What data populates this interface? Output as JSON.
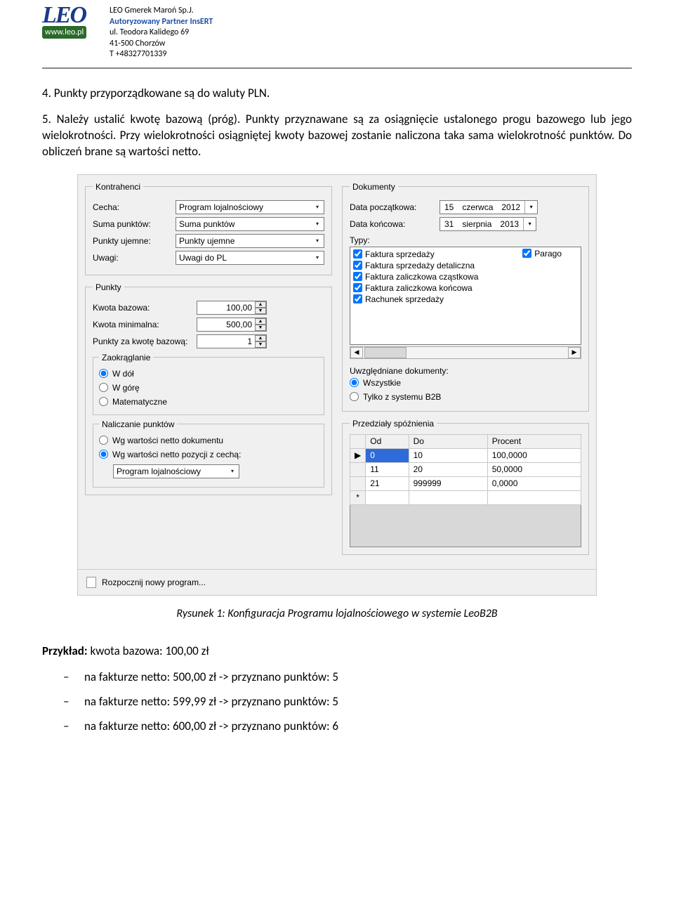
{
  "header": {
    "company1": "LEO Gmerek Maroń Sp.J.",
    "company2": "Autoryzowany Partner InsERT",
    "company3": "ul. Teodora Kalidego 69",
    "company4": "41-500 Chorzów",
    "company5": "T +48327701339",
    "logo_text": "LEO",
    "logo_url": "www.leo.pl"
  },
  "body": {
    "para4": "4. Punkty przyporządkowane są do waluty PLN.",
    "para5": "5. Należy ustalić kwotę bazową (próg). Punkty przyznawane są za osiągnięcie ustalonego progu bazowego lub jego wielokrotności. Przy wielokrotności osiągniętej kwoty bazowej zostanie naliczona taka sama wielokrotność punktów. Do obliczeń brane są wartości netto."
  },
  "dialog": {
    "kontrahenci": {
      "legend": "Kontrahenci",
      "cecha_label": "Cecha:",
      "cecha_value": "Program lojalnościowy",
      "suma_label": "Suma punktów:",
      "suma_value": "Suma punktów",
      "ujemne_label": "Punkty ujemne:",
      "ujemne_value": "Punkty ujemne",
      "uwagi_label": "Uwagi:",
      "uwagi_value": "Uwagi do PL"
    },
    "punkty": {
      "legend": "Punkty",
      "kwota_bazowa_label": "Kwota bazowa:",
      "kwota_bazowa_value": "100,00",
      "kwota_min_label": "Kwota minimalna:",
      "kwota_min_value": "500,00",
      "punkty_za_label": "Punkty za kwotę bazową:",
      "punkty_za_value": "1",
      "zaokraglanie_legend": "Zaokrąglanie",
      "round_dol": "W dół",
      "round_gore": "W górę",
      "round_mat": "Matematyczne",
      "naliczanie_legend": "Naliczanie punktów",
      "nal_dok": "Wg wartości netto dokumentu",
      "nal_poz": "Wg wartości netto pozycji z cechą:",
      "nal_combo": "Program lojalnościowy"
    },
    "dokumenty": {
      "legend": "Dokumenty",
      "data_pocz_label": "Data początkowa:",
      "data_pocz_d": "15",
      "data_pocz_m": "czerwca",
      "data_pocz_y": "2012",
      "data_konc_label": "Data końcowa:",
      "data_konc_d": "31",
      "data_konc_m": "sierpnia",
      "data_konc_y": "2013",
      "typy_label": "Typy:",
      "typy": {
        "t1": "Faktura sprzedaży",
        "t2": "Faktura sprzedaży detaliczna",
        "t3": "Faktura zaliczkowa cząstkowa",
        "t4": "Faktura zaliczkowa końcowa",
        "t5": "Rachunek sprzedaży",
        "t6": "Parago"
      },
      "uwzg_label": "Uwzględniane dokumenty:",
      "uwzg_all": "Wszystkie",
      "uwzg_b2b": "Tylko z systemu B2B"
    },
    "spoznienia": {
      "legend": "Przedziały spóźnienia",
      "cols": {
        "od": "Od",
        "do": "Do",
        "procent": "Procent"
      },
      "rows": [
        {
          "marker": "▶",
          "od": "0",
          "do": "10",
          "procent": "100,0000"
        },
        {
          "marker": "",
          "od": "11",
          "do": "20",
          "procent": "50,0000"
        },
        {
          "marker": "",
          "od": "21",
          "do": "999999",
          "procent": "0,0000"
        },
        {
          "marker": "*",
          "od": "",
          "do": "",
          "procent": ""
        }
      ]
    },
    "bottom_link": "Rozpocznij nowy program..."
  },
  "caption": "Rysunek 1: Konfiguracja Programu lojalnościowego w systemie LeoB2B",
  "example": {
    "head_b": "Przykład:",
    "head_rest": " kwota bazowa: 100,00 zł",
    "li1": "na fakturze netto: 500,00 zł -> przyznano punktów: 5",
    "li2": "na fakturze netto: 599,99 zł -> przyznano punktów: 5",
    "li3": "na fakturze netto: 600,00 zł -> przyznano punktów: 6"
  },
  "chart_data": {
    "type": "table",
    "title": "Przedziały spóźnienia",
    "columns": [
      "Od",
      "Do",
      "Procent"
    ],
    "rows": [
      [
        0,
        10,
        100.0
      ],
      [
        11,
        20,
        50.0
      ],
      [
        21,
        999999,
        0.0
      ]
    ]
  }
}
